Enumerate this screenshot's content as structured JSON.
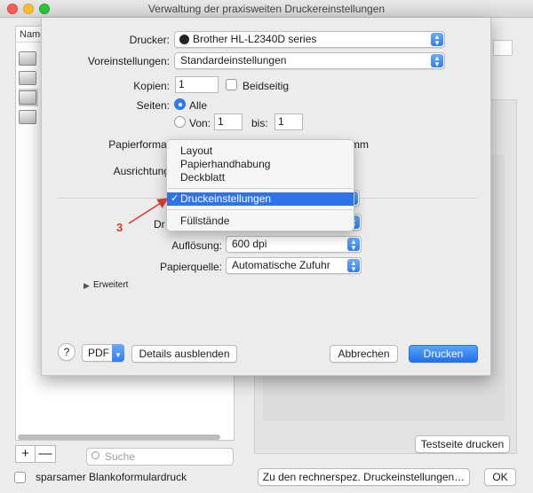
{
  "window": {
    "title": "Verwaltung der praxisweiten Druckereinstellungen"
  },
  "list": {
    "header": "Name"
  },
  "search": {
    "placeholder": "Suche"
  },
  "bottom": {
    "plus": "+",
    "minus": "—",
    "checkbox_label": "sparsamer Blankoformulardruck",
    "computer_settings_button": "Zu den rechnerspez. Druckeinstellungen…",
    "ok_button": "OK",
    "test_print_button": "Testseite drucken"
  },
  "dialog": {
    "printer_label": "Drucker:",
    "printer_value": "Brother HL-L2340D series",
    "presets_label": "Voreinstellungen:",
    "presets_value": "Standardeinstellungen",
    "copies_label": "Kopien:",
    "copies_value": "1",
    "duplex_label": "Beidseitig",
    "pages_label": "Seiten:",
    "pages_all": "Alle",
    "pages_from": "Von:",
    "pages_from_value": "1",
    "pages_to": "bis:",
    "pages_to_value": "1",
    "paper_format_label": "Papierformat",
    "paper_format_unit": "mm",
    "orientation_label": "Ausrichtung",
    "section_label_partial": "Dr",
    "resolution_label": "Auflösung:",
    "resolution_value": "600 dpi",
    "paper_source_label": "Papierquelle:",
    "paper_source_value": "Automatische Zufuhr",
    "advanced_label": "Erweitert",
    "help": "?",
    "pdf_button": "PDF",
    "hide_details_button": "Details ausblenden",
    "cancel_button": "Abbrechen",
    "print_button": "Drucken"
  },
  "menu": {
    "items": [
      "Layout",
      "Papierhandhabung",
      "Deckblatt",
      "Druckeinstellungen",
      "Füllstände"
    ],
    "selected": "Druckeinstellungen"
  },
  "callout": {
    "number": "3",
    "color": "#d33a2c"
  },
  "colors": {
    "accent": "#2f73e8"
  }
}
